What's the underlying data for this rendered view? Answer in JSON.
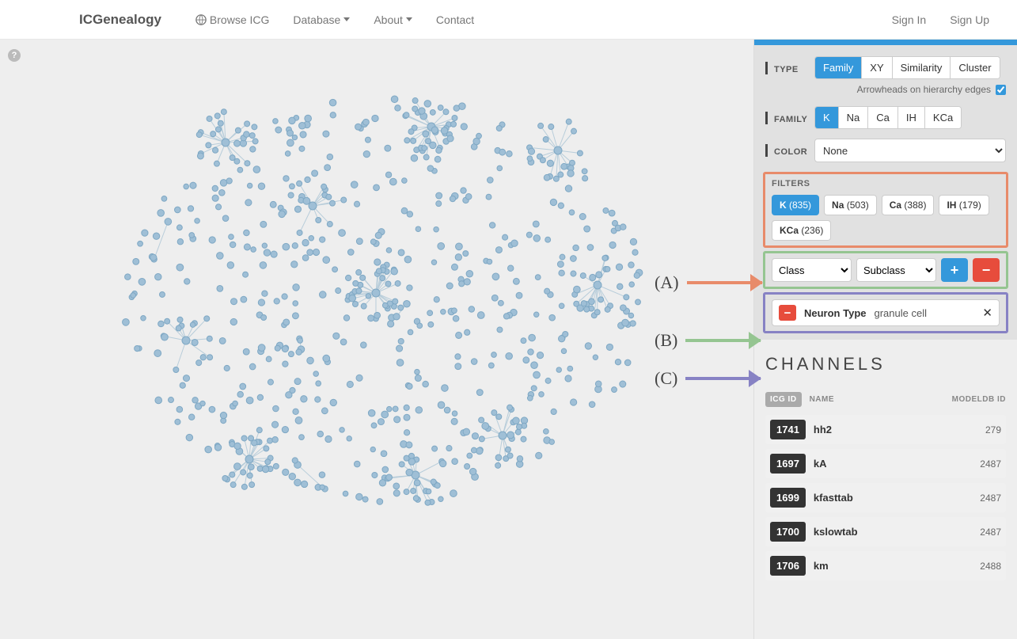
{
  "nav": {
    "brand": "ICGenealogy",
    "items": [
      "Browse ICG",
      "Database",
      "About",
      "Contact"
    ],
    "right": [
      "Sign In",
      "Sign Up"
    ]
  },
  "callouts": {
    "a": "(A)",
    "b": "(B)",
    "c": "(C)"
  },
  "sidebar": {
    "type": {
      "label": "TYPE",
      "options": [
        "Family",
        "XY",
        "Similarity",
        "Cluster"
      ],
      "active": 0
    },
    "arrowheads_label": "Arrowheads on hierarchy edges",
    "family": {
      "label": "FAMILY",
      "options": [
        "K",
        "Na",
        "Ca",
        "IH",
        "KCa"
      ],
      "active": 0
    },
    "color": {
      "label": "COLOR",
      "selected": "None"
    },
    "filters": {
      "label": "FILTERS",
      "pills": [
        {
          "name": "K",
          "count": "(835)",
          "active": true
        },
        {
          "name": "Na",
          "count": "(503)",
          "active": false
        },
        {
          "name": "Ca",
          "count": "(388)",
          "active": false
        },
        {
          "name": "IH",
          "count": "(179)",
          "active": false
        },
        {
          "name": "KCa",
          "count": "(236)",
          "active": false
        }
      ],
      "class_sel": "Class",
      "subclass_sel": "Subclass",
      "active_filter": {
        "name": "Neuron Type",
        "value": "granule cell"
      }
    }
  },
  "channels": {
    "title": "CHANNELS",
    "head": {
      "icg": "ICG ID",
      "name": "NAME",
      "model": "MODELDB ID"
    },
    "rows": [
      {
        "icg": "1741",
        "name": "hh2",
        "model": "279"
      },
      {
        "icg": "1697",
        "name": "kA",
        "model": "2487"
      },
      {
        "icg": "1699",
        "name": "kfasttab",
        "model": "2487"
      },
      {
        "icg": "1700",
        "name": "kslowtab",
        "model": "2487"
      },
      {
        "icg": "1706",
        "name": "km",
        "model": "2488"
      }
    ]
  }
}
